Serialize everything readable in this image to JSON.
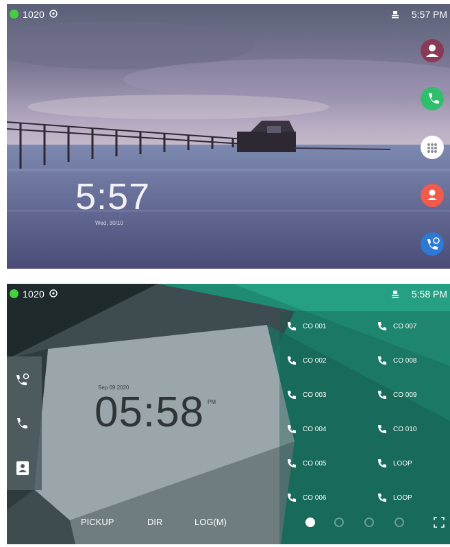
{
  "lock_screen": {
    "status": {
      "line_status_color": "#43d23f",
      "extension": "1020",
      "time": "5:57 PM",
      "icons": [
        "line-signal-icon",
        "network-icon"
      ]
    },
    "clock": "5:57",
    "date": "Wed, 30/10",
    "right_buttons": [
      {
        "name": "contacts-button",
        "icon": "person-icon",
        "color": "#8b3a55"
      },
      {
        "name": "dial-button",
        "icon": "phone-icon",
        "color": "#2fbf6c"
      },
      {
        "name": "menu-button",
        "icon": "grid-icon",
        "color": "#ffffff"
      },
      {
        "name": "directory-button",
        "icon": "person-icon",
        "color": "#f15b4d"
      },
      {
        "name": "history-button",
        "icon": "call-history-icon",
        "color": "#2d7ad6"
      }
    ]
  },
  "home_screen": {
    "status": {
      "line_status_color": "#43d23f",
      "extension": "1020",
      "time": "5:58 PM"
    },
    "clock": {
      "date": "Sep 09 2020",
      "time": "05:58",
      "ampm": "PM"
    },
    "side_icons": [
      "call-history-icon",
      "phone-icon",
      "contacts-icon"
    ],
    "softkeys": [
      "PICKUP",
      "DIR",
      "LOG(M)"
    ],
    "dss_keys": [
      [
        "CO 001",
        "CO 007"
      ],
      [
        "CO 002",
        "CO 008"
      ],
      [
        "CO 003",
        "CO 009"
      ],
      [
        "CO 004",
        "CO 010"
      ],
      [
        "CO 005",
        "LOOP"
      ],
      [
        "CO 006",
        "LOOP"
      ]
    ],
    "page_count": 4,
    "active_page": 1
  }
}
